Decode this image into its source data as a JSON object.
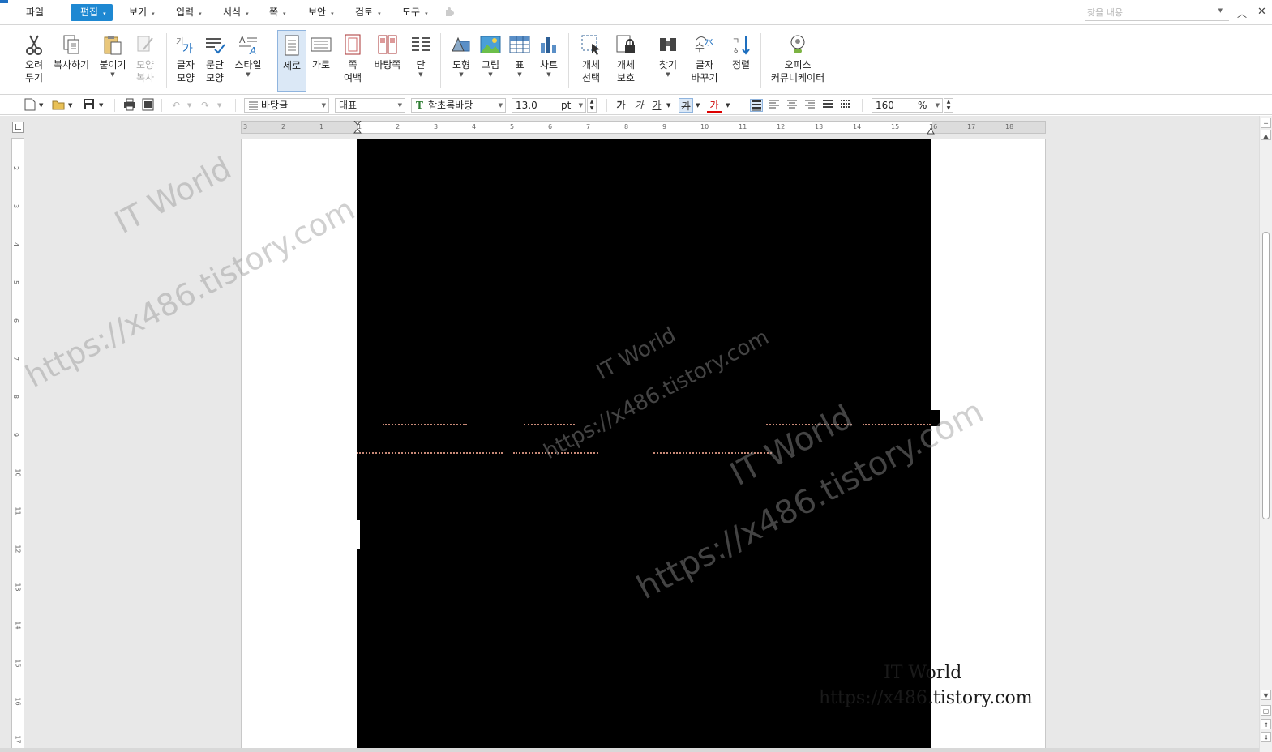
{
  "menu": {
    "items": [
      {
        "label": "파일",
        "dropdown": ""
      },
      {
        "label": "편집",
        "dropdown": "▾"
      },
      {
        "label": "보기",
        "dropdown": "▾"
      },
      {
        "label": "입력",
        "dropdown": "▾"
      },
      {
        "label": "서식",
        "dropdown": "▾"
      },
      {
        "label": "쪽",
        "dropdown": "▾"
      },
      {
        "label": "보안",
        "dropdown": "▾"
      },
      {
        "label": "검토",
        "dropdown": "▾"
      },
      {
        "label": "도구",
        "dropdown": "▾"
      }
    ],
    "active_color": "#1e88d2",
    "search_placeholder": "찾을 내용"
  },
  "ribbon": {
    "cut": {
      "line1": "오려",
      "line2": "두기"
    },
    "copy": {
      "line1": "복사하기"
    },
    "paste": {
      "line1": "붙이기"
    },
    "format_copy": {
      "line1": "모양",
      "line2": "복사"
    },
    "char_shape": {
      "line1": "글자",
      "line2": "모양"
    },
    "para_shape": {
      "line1": "문단",
      "line2": "모양"
    },
    "style": {
      "line1": "스타일"
    },
    "portrait": {
      "line1": "세로"
    },
    "landscape": {
      "line1": "가로"
    },
    "margin": {
      "line1": "쪽",
      "line2": "여백"
    },
    "pages_bg": {
      "line1": "바탕쪽"
    },
    "columns": {
      "line1": "단"
    },
    "shape": {
      "line1": "도형"
    },
    "picture": {
      "line1": "그림"
    },
    "table": {
      "line1": "표"
    },
    "chart": {
      "line1": "차트"
    },
    "obj_select": {
      "line1": "개체",
      "line2": "선택"
    },
    "obj_protect": {
      "line1": "개체",
      "line2": "보호"
    },
    "find": {
      "line1": "찾기"
    },
    "replace": {
      "line1": "글자",
      "line2": "바꾸기"
    },
    "sort": {
      "line1": "정렬"
    },
    "office_comm": {
      "line1": "오피스",
      "line2": "커뮤니케이터"
    }
  },
  "format": {
    "style_name": "바탕글",
    "lang": "대표",
    "font_name": "함초롬바탕",
    "font_size": "13.0",
    "size_unit": "pt",
    "bold": "가",
    "italic": "가",
    "underline": "가",
    "strike": "가",
    "color": "가",
    "zoom": "160",
    "zoom_unit": "%"
  },
  "ruler": {
    "h_ticks": [
      "3",
      "2",
      "1",
      "1",
      "2",
      "3",
      "4",
      "5",
      "6",
      "7",
      "8",
      "9",
      "10",
      "11",
      "12",
      "13",
      "14",
      "15",
      "16",
      "17",
      "18"
    ],
    "v_ticks": [
      "2",
      "3",
      "4",
      "5",
      "6",
      "7",
      "8",
      "9",
      "10",
      "11",
      "12",
      "13",
      "14",
      "15",
      "16",
      "17"
    ]
  },
  "watermark": {
    "line1": "IT World",
    "line2": "https://x486.tistory.com"
  },
  "colors": {
    "accent": "#1e88d2",
    "image_bg": "#000000",
    "dash": "#c98a78"
  }
}
